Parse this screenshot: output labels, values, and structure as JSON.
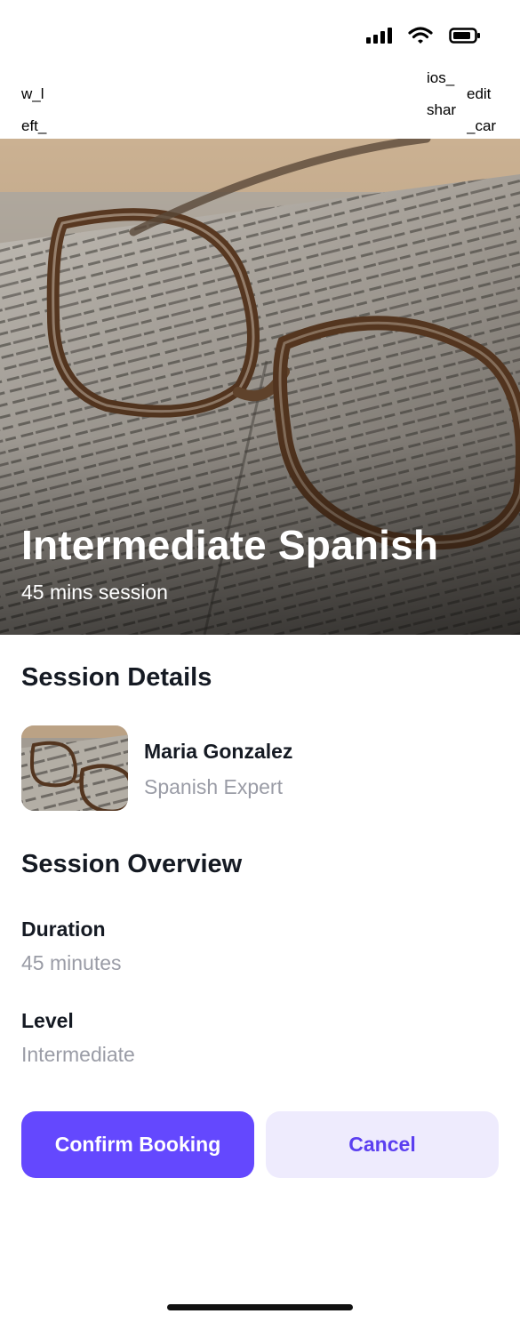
{
  "status_bar": {
    "icons": [
      "signal-icon",
      "wifi-icon",
      "battery-icon"
    ]
  },
  "nav": {
    "left_icon_alt": "w_left_",
    "share_icon_alt": "ios_share_",
    "edit_icon_alt": "edit_car"
  },
  "hero": {
    "title": "Intermediate Spanish",
    "subtitle": "45 mins session",
    "image": "eyeglasses-on-open-book"
  },
  "session_details": {
    "heading": "Session Details",
    "tutor_name": "Maria Gonzalez",
    "tutor_role": "Spanish Expert"
  },
  "session_overview": {
    "heading": "Session Overview",
    "duration_label": "Duration",
    "duration_value": "45 minutes",
    "level_label": "Level",
    "level_value": "Intermediate"
  },
  "actions": {
    "confirm_label": "Confirm Booking",
    "cancel_label": "Cancel"
  },
  "colors": {
    "primary": "#6448fe",
    "secondary_bg": "#eeebfd",
    "secondary_text": "#5b3ff0",
    "muted_text": "#9a9ca6",
    "heading_text": "#151a23"
  }
}
